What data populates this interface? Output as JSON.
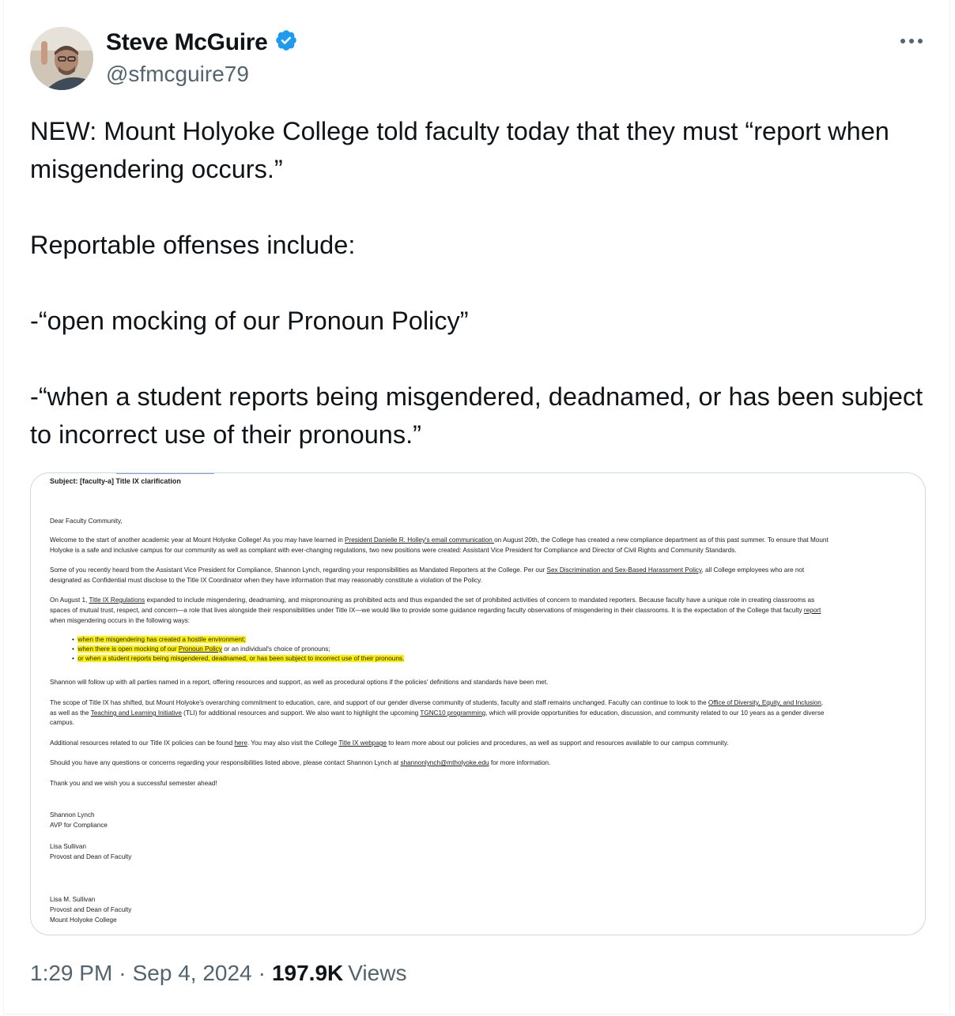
{
  "author": {
    "name": "Steve McGuire",
    "handle": "@sfmcguire79",
    "verified": true,
    "badge_color": "#1d9bf0"
  },
  "tweet": {
    "paragraphs": [
      "NEW: Mount Holyoke College told faculty today that they must “report when misgendering occurs.”",
      "Reportable offenses include:",
      "-“open mocking of our Pronoun Policy”",
      "-“when a student reports being misgendered, deadnamed, or has been subject to incorrect use of their pronouns.”"
    ]
  },
  "document": {
    "subject": "Subject: [faculty-a] Title IX clarification",
    "greeting": "Dear Faculty Community,",
    "p1_a": "Welcome to the start of another academic year at Mount Holyoke College! As you may have learned in ",
    "p1_link": "President Danielle R. Holley's email communication ",
    "p1_b": "on August 20th, the College has created a new compliance department as of this past summer. To ensure that Mount",
    "p1_line2": "Holyoke is a safe and inclusive campus for our community as well as compliant with ever-changing regulations, two new positions were created: Assistant Vice President for Compliance and Director of Civil Rights and Community Standards.",
    "p2_a": "Some of you recently heard from the Assistant Vice President for Compliance, Shannon Lynch, regarding your responsibilities as Mandated Reporters at the College. Per our ",
    "p2_link": "Sex Discrimination and Sex-Based Harassment Policy",
    "p2_b": ", all College employees who are not",
    "p2_line2": "designated as Confidential must disclose to the Title IX Coordinator when they have information that may reasonably constitute a violation of the Policy.",
    "p3_a": "On August 1, ",
    "p3_link": "Title IX Regulations",
    "p3_b": " expanded to include misgendering, deadnaming, and mispronouning as prohibited acts and thus expanded the set of prohibited activities of concern to mandated reporters. Because faculty have a unique role in creating classrooms as",
    "p3_line2_a": "spaces of mutual trust, respect, and concern—a role that lives alongside their responsibilities under Title IX—we would like to provide some guidance regarding faculty observations of misgendering in their classrooms. It is the expectation of the College that faculty ",
    "p3_line2_link": "report",
    "p3_line3": "when misgendering occurs in the following ways:",
    "bullet1": "when the misgendering has created a hostile environment;",
    "bullet2_a": "when there is open mocking of our ",
    "bullet2_link": "Pronoun Policy",
    "bullet2_b": " or an individual's choice of pronouns;",
    "bullet3": "or when a student reports being misgendered, deadnamed, or has been subject to incorrect use of their pronouns.",
    "p4": "Shannon will follow up with all parties named in a report, offering resources and support, as well as procedural options if the policies' definitions and standards have been met.",
    "p5_a": "The scope of Title IX has shifted, but Mount Holyoke's overarching commitment to education, care, and support of our gender diverse community of students, faculty and staff remains unchanged. Faculty can continue to look to the ",
    "p5_link1": "Office of Diversity, Equity, and Inclusion",
    "p5_b": ",",
    "p5_line2_a": "as well as the ",
    "p5_link2": "Teaching and Learning Initiative",
    "p5_line2_b": " (TLI) for additional resources and support. We also want to highlight the upcoming ",
    "p5_link3": "TGNC10 programming",
    "p5_line2_c": ", which will provide opportunities for education, discussion, and community related to our 10 years as a gender diverse",
    "p5_line3": "campus.",
    "p6_a": "Additional resources related to our Title IX policies can be found ",
    "p6_link1": "here",
    "p6_b": ". You may also visit the College ",
    "p6_link2": "Title IX webpage",
    "p6_c": " to learn more about our policies and procedures, as well as support and resources available to our campus community.",
    "p7_a": "Should you have any questions or concerns regarding your responsibilities listed above, please contact Shannon Lynch at ",
    "p7_link": "shannonlynch@mtholyoke.edu",
    "p7_b": " for more information.",
    "p8": "Thank you and we wish you a successful semester ahead!",
    "sig1_name": "Shannon Lynch",
    "sig1_title": "AVP for Compliance",
    "sig2_name": "Lisa Sullivan",
    "sig2_title": "Provost and Dean of Faculty",
    "sig3_name": "Lisa M. Sullivan",
    "sig3_title": "Provost and Dean of Faculty",
    "sig3_org": "Mount Holyoke College",
    "highlight_color": "#fff200"
  },
  "meta": {
    "time": "1:29 PM",
    "date": "Sep 4, 2024",
    "views_count": "197.9K",
    "views_label": "Views"
  }
}
